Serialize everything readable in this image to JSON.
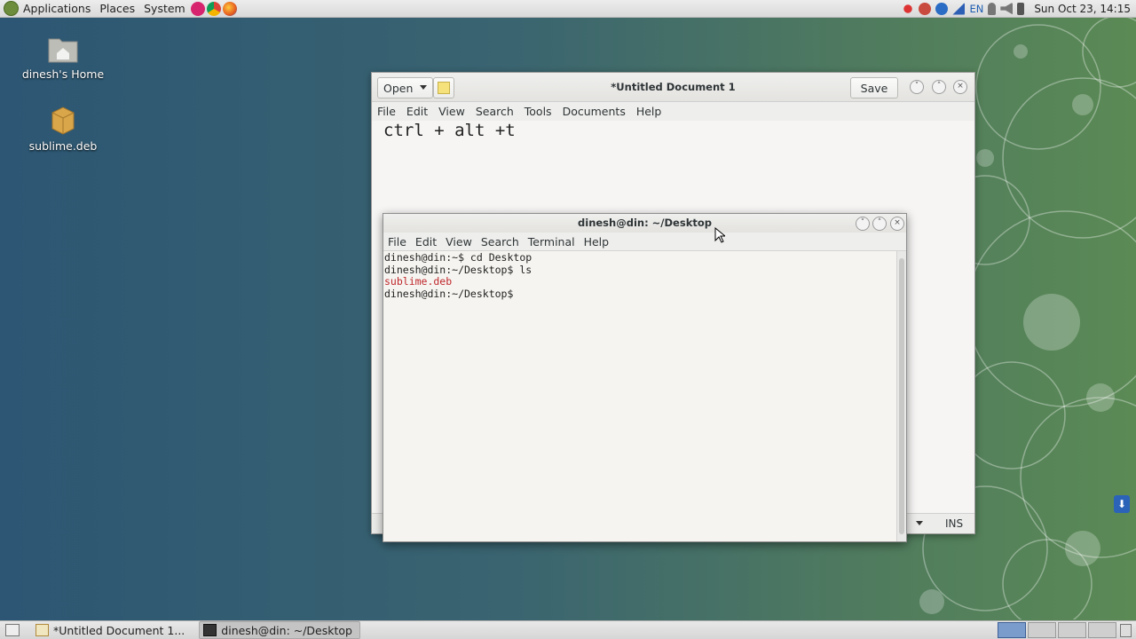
{
  "top_panel": {
    "menus": [
      "Applications",
      "Places",
      "System"
    ],
    "keyboard_layout": "EN",
    "clock": "Sun Oct 23, 14:15"
  },
  "desktop": {
    "icons": [
      {
        "label": "dinesh's Home",
        "icon": "home-folder-icon"
      },
      {
        "label": "sublime.deb",
        "icon": "package-icon"
      }
    ]
  },
  "gedit": {
    "open_label": "Open",
    "title": "*Untitled Document 1",
    "save_label": "Save",
    "menu": [
      "File",
      "Edit",
      "View",
      "Search",
      "Tools",
      "Documents",
      "Help"
    ],
    "content": "ctrl + alt +t",
    "status_mode": "INS"
  },
  "terminal": {
    "title": "dinesh@din: ~/Desktop",
    "menu": [
      "File",
      "Edit",
      "View",
      "Search",
      "Terminal",
      "Help"
    ],
    "lines": [
      {
        "text": "dinesh@din:~$ cd Desktop",
        "color": "default"
      },
      {
        "text": "dinesh@din:~/Desktop$ ls",
        "color": "default"
      },
      {
        "text": "sublime.deb",
        "color": "#c0272d"
      },
      {
        "text": "dinesh@din:~/Desktop$",
        "color": "default"
      }
    ]
  },
  "taskbar": {
    "items": [
      {
        "label": "*Untitled Document 1...",
        "active": false
      },
      {
        "label": "dinesh@din: ~/Desktop",
        "active": true
      }
    ]
  }
}
